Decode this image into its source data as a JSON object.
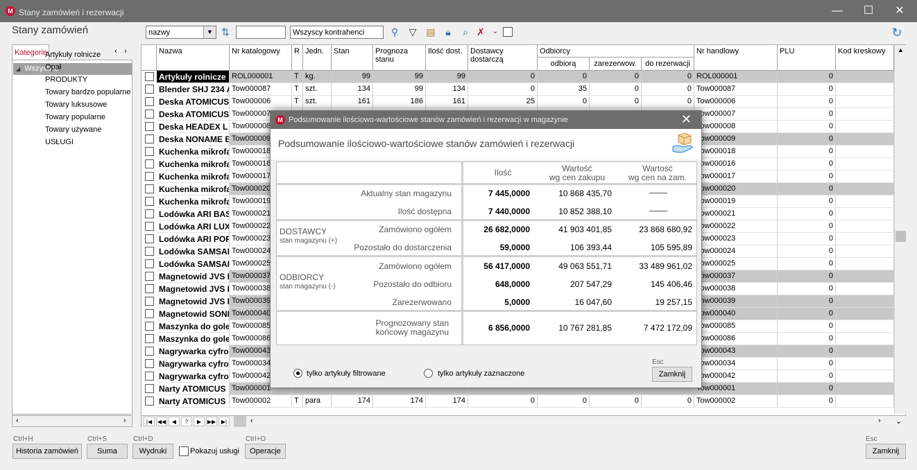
{
  "window": {
    "title": "Stany zamówień i rezerwacji",
    "logo": "M",
    "minimize": "—",
    "maximize": "☐",
    "close": "✕"
  },
  "app": {
    "title": "Stany zamówień"
  },
  "toolbar": {
    "sort_field": "nazwy",
    "search_value": "",
    "contractor_filter": "Wszyscy kontrahenci"
  },
  "categories": {
    "tab_label": "Kategorie",
    "root": "Wszystkie",
    "items": [
      "Artykuły rolnicze",
      "Opał",
      "PRODUKTY",
      "Towary bardzo popularne",
      "Towary luksusowe",
      "Towary popularne",
      "Towary używane",
      "USŁUGI"
    ]
  },
  "grid": {
    "headers": {
      "name": "Nazwa",
      "catalog": "Nr katalogowy",
      "r": "R",
      "unit": "Jedn.",
      "stock": "Stan",
      "forecast": "Prognoza stanu",
      "avail": "Ilość dost.",
      "suppliers": "Dostawcy dostarczą",
      "recipients": "Odbiorcy",
      "receive": "odbiorą",
      "reserved": "zarezerwow.",
      "to_reserve": "do rezerwacji",
      "trade_no": "Nr handlowy",
      "plu": "PLU",
      "barcode": "Kod kreskowy"
    },
    "rows": [
      {
        "name": "Artykuły rolnicze",
        "catalog": "ROL000001",
        "r": "T",
        "unit": "kg.",
        "stock": "99",
        "forecast": "99",
        "avail": "99",
        "sup": "0",
        "rec": "0",
        "res": "0",
        "tores": "0",
        "trade": "ROL000001",
        "plu": "0"
      },
      {
        "name": "Blender SHJ 234 A",
        "catalog": "Tow000087",
        "r": "T",
        "unit": "szt.",
        "stock": "134",
        "forecast": "99",
        "avail": "134",
        "sup": "0",
        "rec": "35",
        "res": "0",
        "tores": "0",
        "trade": "Tow000087",
        "plu": "0"
      },
      {
        "name": "Deska ATOMICUS",
        "catalog": "Tow000006",
        "r": "T",
        "unit": "szt.",
        "stock": "161",
        "forecast": "186",
        "avail": "161",
        "sup": "25",
        "rec": "0",
        "res": "0",
        "tores": "0",
        "trade": "Tow000006",
        "plu": "0"
      },
      {
        "name": "Deska ATOMICUS",
        "catalog": "Tow000007",
        "r": "",
        "unit": "",
        "stock": "",
        "forecast": "",
        "avail": "",
        "sup": "",
        "rec": "",
        "res": "",
        "tores": "",
        "trade": "Tow000007",
        "plu": "0"
      },
      {
        "name": "Deska HEADEX L",
        "catalog": "Tow000008",
        "r": "",
        "unit": "",
        "stock": "",
        "forecast": "",
        "avail": "",
        "sup": "",
        "rec": "",
        "res": "",
        "tores": "",
        "trade": "Tow000008",
        "plu": "0"
      },
      {
        "name": "Deska NONAME B",
        "catalog": "Tow000009",
        "r": "",
        "unit": "",
        "stock": "",
        "forecast": "",
        "avail": "",
        "sup": "",
        "rec": "",
        "res": "",
        "tores": "",
        "trade": "Tow000009",
        "plu": "0"
      },
      {
        "name": "Kuchenka mikrofa",
        "catalog": "Tow000018",
        "r": "",
        "unit": "",
        "stock": "",
        "forecast": "",
        "avail": "",
        "sup": "",
        "rec": "",
        "res": "",
        "tores": "",
        "trade": "Tow000018",
        "plu": "0"
      },
      {
        "name": "Kuchenka mikrofa",
        "catalog": "Tow000016",
        "r": "",
        "unit": "",
        "stock": "",
        "forecast": "",
        "avail": "",
        "sup": "",
        "rec": "",
        "res": "",
        "tores": "",
        "trade": "Tow000016",
        "plu": "0"
      },
      {
        "name": "Kuchenka mikrofa",
        "catalog": "Tow000017",
        "r": "",
        "unit": "",
        "stock": "",
        "forecast": "",
        "avail": "",
        "sup": "",
        "rec": "",
        "res": "",
        "tores": "",
        "trade": "Tow000017",
        "plu": "0"
      },
      {
        "name": "Kuchenka mikrofa",
        "catalog": "Tow000020",
        "r": "",
        "unit": "",
        "stock": "",
        "forecast": "",
        "avail": "",
        "sup": "",
        "rec": "",
        "res": "",
        "tores": "",
        "trade": "Tow000020",
        "plu": "0"
      },
      {
        "name": "Kuchenka mikrofa",
        "catalog": "Tow000019",
        "r": "",
        "unit": "",
        "stock": "",
        "forecast": "",
        "avail": "",
        "sup": "",
        "rec": "",
        "res": "",
        "tores": "",
        "trade": "Tow000019",
        "plu": "0"
      },
      {
        "name": "Lodówka ARI BAS",
        "catalog": "Tow000021",
        "r": "",
        "unit": "",
        "stock": "",
        "forecast": "",
        "avail": "",
        "sup": "",
        "rec": "",
        "res": "",
        "tores": "",
        "trade": "Tow000021",
        "plu": "0"
      },
      {
        "name": "Lodówka ARI LUX",
        "catalog": "Tow000022",
        "r": "",
        "unit": "",
        "stock": "",
        "forecast": "",
        "avail": "",
        "sup": "",
        "rec": "",
        "res": "",
        "tores": "",
        "trade": "Tow000022",
        "plu": "0"
      },
      {
        "name": "Lodówka ARI POP",
        "catalog": "Tow000023",
        "r": "",
        "unit": "",
        "stock": "",
        "forecast": "",
        "avail": "",
        "sup": "",
        "rec": "",
        "res": "",
        "tores": "",
        "trade": "Tow000023",
        "plu": "0"
      },
      {
        "name": "Lodówka SAMSAN",
        "catalog": "Tow000024",
        "r": "",
        "unit": "",
        "stock": "",
        "forecast": "",
        "avail": "",
        "sup": "",
        "rec": "",
        "res": "",
        "tores": "",
        "trade": "Tow000024",
        "plu": "0"
      },
      {
        "name": "Lodówka SAMSAN",
        "catalog": "Tow000025",
        "r": "",
        "unit": "",
        "stock": "",
        "forecast": "",
        "avail": "",
        "sup": "",
        "rec": "",
        "res": "",
        "tores": "",
        "trade": "Tow000025",
        "plu": "0"
      },
      {
        "name": "Magnetowid JVS E",
        "catalog": "Tow000037",
        "r": "",
        "unit": "",
        "stock": "",
        "forecast": "",
        "avail": "",
        "sup": "",
        "rec": "",
        "res": "",
        "tores": "",
        "trade": "Tow000037",
        "plu": "0"
      },
      {
        "name": "Magnetowid JVS L",
        "catalog": "Tow000038",
        "r": "",
        "unit": "",
        "stock": "",
        "forecast": "",
        "avail": "",
        "sup": "",
        "rec": "",
        "res": "",
        "tores": "",
        "trade": "Tow000038",
        "plu": "0"
      },
      {
        "name": "Magnetowid JVS P",
        "catalog": "Tow000039",
        "r": "",
        "unit": "",
        "stock": "",
        "forecast": "",
        "avail": "",
        "sup": "",
        "rec": "",
        "res": "",
        "tores": "",
        "trade": "Tow000039",
        "plu": "0"
      },
      {
        "name": "Magnetowid SONI",
        "catalog": "Tow000040",
        "r": "",
        "unit": "",
        "stock": "",
        "forecast": "",
        "avail": "",
        "sup": "",
        "rec": "",
        "res": "",
        "tores": "",
        "trade": "Tow000040",
        "plu": "0"
      },
      {
        "name": "Maszynka do gole",
        "catalog": "Tow000085",
        "r": "",
        "unit": "",
        "stock": "",
        "forecast": "",
        "avail": "",
        "sup": "",
        "rec": "",
        "res": "",
        "tores": "",
        "trade": "Tow000085",
        "plu": "0"
      },
      {
        "name": "Maszynka do gole",
        "catalog": "Tow000086",
        "r": "",
        "unit": "",
        "stock": "",
        "forecast": "",
        "avail": "",
        "sup": "",
        "rec": "",
        "res": "",
        "tores": "",
        "trade": "Tow000086",
        "plu": "0"
      },
      {
        "name": "Nagrywarka cyfro",
        "catalog": "Tow000043",
        "r": "",
        "unit": "",
        "stock": "",
        "forecast": "",
        "avail": "",
        "sup": "",
        "rec": "",
        "res": "",
        "tores": "",
        "trade": "Tow000043",
        "plu": "0"
      },
      {
        "name": "Nagrywarka cyfro",
        "catalog": "Tow000034",
        "r": "",
        "unit": "",
        "stock": "",
        "forecast": "",
        "avail": "",
        "sup": "",
        "rec": "",
        "res": "",
        "tores": "",
        "trade": "Tow000034",
        "plu": "0"
      },
      {
        "name": "Nagrywarka cyfro",
        "catalog": "Tow000042",
        "r": "",
        "unit": "",
        "stock": "",
        "forecast": "",
        "avail": "",
        "sup": "",
        "rec": "",
        "res": "",
        "tores": "",
        "trade": "Tow000042",
        "plu": "0"
      },
      {
        "name": "Narty ATOMICUS",
        "catalog": "Tow000001",
        "r": "",
        "unit": "",
        "stock": "",
        "forecast": "",
        "avail": "",
        "sup": "",
        "rec": "",
        "res": "",
        "tores": "",
        "trade": "Tow000001",
        "plu": "0"
      },
      {
        "name": "Narty ATOMICUS",
        "catalog": "Tow000002",
        "r": "T",
        "unit": "para",
        "stock": "174",
        "forecast": "174",
        "avail": "174",
        "sup": "0",
        "rec": "0",
        "res": "0",
        "tores": "0",
        "trade": "Tow000002",
        "plu": "0"
      }
    ],
    "navigator": [
      "|◀",
      "◀◀",
      "◀",
      "?",
      "▶",
      "▶▶",
      "▶|"
    ]
  },
  "footer": {
    "history": {
      "shortcut": "Ctrl+H",
      "label": "Historia zamówień"
    },
    "sum": {
      "shortcut": "Ctrl+S",
      "label": "Suma"
    },
    "print": {
      "shortcut": "Ctrl+D",
      "label": "Wydruki"
    },
    "show_services": "Pokazuj usługi",
    "ops": {
      "shortcut": "Ctrl+O",
      "label": "Operacje"
    },
    "close": {
      "shortcut": "Esc",
      "label": "Zamknij"
    }
  },
  "dialog": {
    "title": "Podsumowanie ilościowo-wartościowe stanów zamówień i rezerwacji w magazynie",
    "heading": "Podsumowanie ilościowo-wartościowe stanów zamówień i rezerwacji",
    "col_qty": "Ilość",
    "col_purchase_1": "Wartość",
    "col_purchase_2": "wg cen zakupu",
    "col_order_1": "Wartość",
    "col_order_2": "wg cen na zam.",
    "rows": [
      {
        "label": "Aktualny stan magazynu",
        "qty": "7 445,0000",
        "purchase": "10 868 435,70",
        "order": ""
      },
      {
        "label": "Ilość dostępna",
        "qty": "7 440,0000",
        "purchase": "10 852 388,10",
        "order": ""
      },
      {
        "label": "Zamówiono ogółem",
        "qty": "26 682,0000",
        "purchase": "41 903 401,85",
        "order": "23 868 680,92"
      },
      {
        "label": "Pozostało do dostarczenia",
        "qty": "59,0000",
        "purchase": "106 393,44",
        "order": "105 595,89"
      },
      {
        "label": "Zamówiono ogółem",
        "qty": "56 417,0000",
        "purchase": "49 063 551,71",
        "order": "33 489 961,02"
      },
      {
        "label": "Pozostało do odbioru",
        "qty": "648,0000",
        "purchase": "207 547,29",
        "order": "145 406,46"
      },
      {
        "label": "Zarezerwowano",
        "qty": "5,0000",
        "purchase": "16 047,60",
        "order": "19 257,15"
      }
    ],
    "forecast_1": "Prognozowany stan",
    "forecast_2": "końcowy magazynu",
    "forecast_qty": "6 856,0000",
    "forecast_purchase": "10 767 281,85",
    "forecast_order": "7 472 172,09",
    "suppliers_1": "DOSTAWCY",
    "suppliers_2": "stan magazynu (+)",
    "recipients_1": "ODBIORCY",
    "recipients_2": "stan magazynu (-)",
    "radio_filtered": "tylko artykuły filtrowane",
    "radio_selected": "tylko artykuły zaznaczone",
    "esc": "Esc",
    "close": "Zamknij",
    "logo": "M",
    "x": "✕"
  }
}
